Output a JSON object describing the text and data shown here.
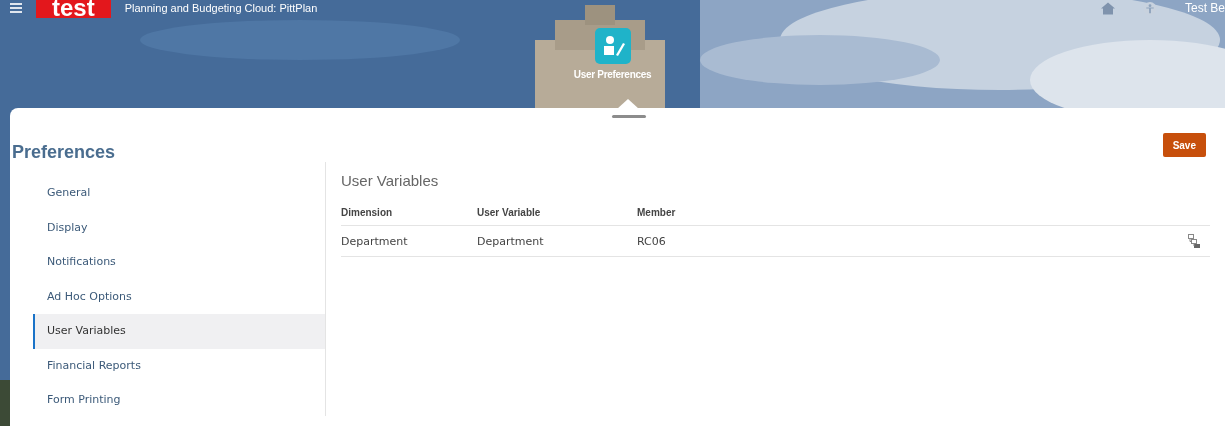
{
  "header": {
    "logo": "test",
    "app_title": "Planning and Budgeting Cloud: PittPlan",
    "user_name": "Test Be",
    "page_icon_label": "User Preferences"
  },
  "page": {
    "title": "Preferences",
    "save_button": "Save"
  },
  "sidebar": {
    "items": [
      {
        "label": "General",
        "selected": false
      },
      {
        "label": "Display",
        "selected": false
      },
      {
        "label": "Notifications",
        "selected": false
      },
      {
        "label": "Ad Hoc Options",
        "selected": false
      },
      {
        "label": "User Variables",
        "selected": true
      },
      {
        "label": "Financial Reports",
        "selected": false
      },
      {
        "label": "Form Printing",
        "selected": false
      }
    ]
  },
  "content": {
    "title": "User Variables",
    "table": {
      "columns": [
        "Dimension",
        "User Variable",
        "Member"
      ],
      "rows": [
        {
          "cells": [
            "Department",
            "Department",
            "RC06"
          ]
        }
      ]
    }
  }
}
